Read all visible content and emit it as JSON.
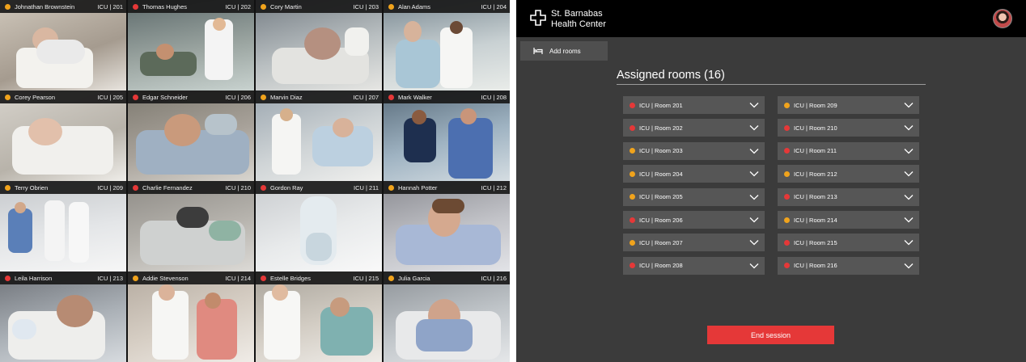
{
  "colors": {
    "red": "#e53838",
    "orange": "#f0a31c"
  },
  "tiles": [
    {
      "name": "Johnathan Brownstein",
      "room": "ICU | 201",
      "status": "orange"
    },
    {
      "name": "Thomas Hughes",
      "room": "ICU | 202",
      "status": "red"
    },
    {
      "name": "Cory Martin",
      "room": "ICU | 203",
      "status": "orange"
    },
    {
      "name": "Alan Adams",
      "room": "ICU | 204",
      "status": "orange"
    },
    {
      "name": "Corey Pearson",
      "room": "ICU | 205",
      "status": "orange"
    },
    {
      "name": "Edgar Schneider",
      "room": "ICU | 206",
      "status": "red"
    },
    {
      "name": "Marvin Diaz",
      "room": "ICU | 207",
      "status": "orange"
    },
    {
      "name": "Mark Walker",
      "room": "ICU | 208",
      "status": "red"
    },
    {
      "name": "Terry Obrien",
      "room": "ICU | 209",
      "status": "orange"
    },
    {
      "name": "Charlie Fernandez",
      "room": "ICU | 210",
      "status": "red"
    },
    {
      "name": "Gordon Ray",
      "room": "ICU | 211",
      "status": "red"
    },
    {
      "name": "Hannah Potter",
      "room": "ICU | 212",
      "status": "orange"
    },
    {
      "name": "Leila Harrison",
      "room": "ICU | 213",
      "status": "red"
    },
    {
      "name": "Addie Stevenson",
      "room": "ICU | 214",
      "status": "orange"
    },
    {
      "name": "Estelle Bridges",
      "room": "ICU | 215",
      "status": "red"
    },
    {
      "name": "Julia Garcia",
      "room": "ICU | 216",
      "status": "orange"
    }
  ],
  "header": {
    "brand_line1": "St. Barnabas",
    "brand_line2": "Health Center",
    "logo_icon": "medical-cross-icon"
  },
  "actions": {
    "add_rooms": "Add rooms",
    "end_session": "End session"
  },
  "assigned": {
    "title": "Assigned rooms (16)",
    "rooms": [
      {
        "label": "ICU | Room 201",
        "status": "red"
      },
      {
        "label": "ICU | Room 202",
        "status": "red"
      },
      {
        "label": "ICU | Room 203",
        "status": "orange"
      },
      {
        "label": "ICU | Room 204",
        "status": "orange"
      },
      {
        "label": "ICU | Room 205",
        "status": "orange"
      },
      {
        "label": "ICU | Room 206",
        "status": "red"
      },
      {
        "label": "ICU | Room 207",
        "status": "orange"
      },
      {
        "label": "ICU | Room 208",
        "status": "red"
      },
      {
        "label": "ICU | Room 209",
        "status": "orange"
      },
      {
        "label": "ICU | Room 210",
        "status": "red"
      },
      {
        "label": "ICU | Room 211",
        "status": "red"
      },
      {
        "label": "ICU | Room 212",
        "status": "orange"
      },
      {
        "label": "ICU | Room 213",
        "status": "red"
      },
      {
        "label": "ICU | Room 214",
        "status": "orange"
      },
      {
        "label": "ICU | Room 215",
        "status": "red"
      },
      {
        "label": "ICU | Room 216",
        "status": "red"
      }
    ]
  }
}
